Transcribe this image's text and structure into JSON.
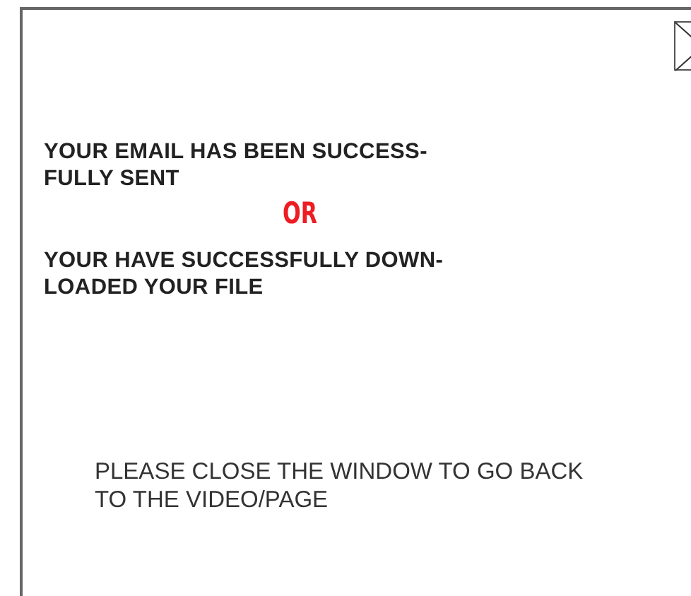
{
  "dialog": {
    "close_button": {
      "kind": "close"
    },
    "messages": [
      {
        "kind": "primary",
        "lines": [
          "YOUR EMAIL HAS BEEN SUCCESS-",
          "FULLY SENT"
        ]
      },
      {
        "kind": "separator",
        "lines": [
          "OR"
        ]
      },
      {
        "kind": "primary",
        "lines": [
          "YOUR HAVE SUCCESSFULLY DOWN-",
          "LOADED YOUR FILE"
        ]
      }
    ],
    "instruction": {
      "lines": [
        "PLEASE CLOSE THE WINDOW TO GO BACK",
        "TO THE VIDEO/PAGE"
      ]
    }
  }
}
